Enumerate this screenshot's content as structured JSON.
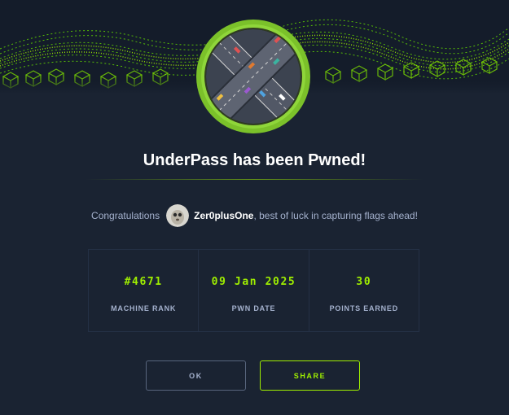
{
  "dialog": {
    "title": "UnderPass has been Pwned!",
    "congrats_prefix": "Congratulations",
    "username": "Zer0plusOne",
    "congrats_suffix": ", best of luck in capturing flags ahead!"
  },
  "stats": [
    {
      "value": "#4671",
      "label": "MACHINE RANK"
    },
    {
      "value": "09 Jan 2025",
      "label": "PWN DATE"
    },
    {
      "value": "30",
      "label": "POINTS EARNED"
    }
  ],
  "buttons": {
    "ok_label": "OK",
    "share_label": "SHARE"
  },
  "colors": {
    "accent": "#9fef00",
    "background": "#1a2332",
    "muted_text": "#a4b1cd"
  },
  "icons": {
    "machine_badge": "underpass-highway-icon",
    "avatar": "user-avatar"
  }
}
